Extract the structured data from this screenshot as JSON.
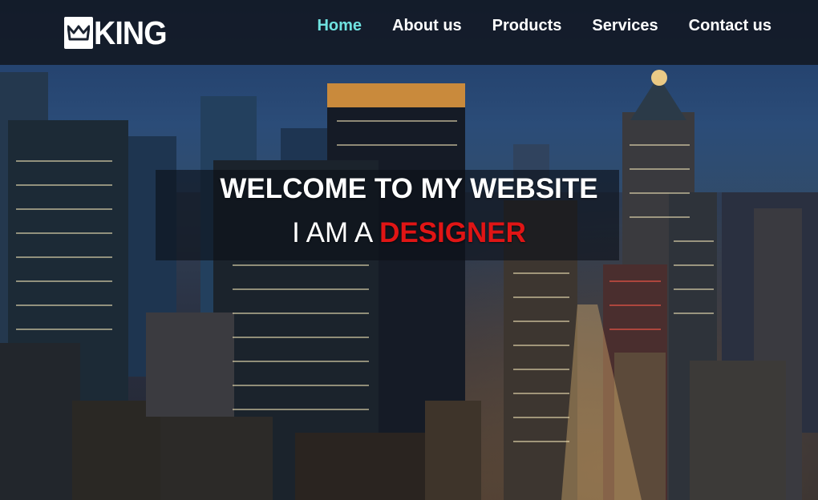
{
  "brand": {
    "logo_text": "KING"
  },
  "nav": {
    "items": [
      {
        "label": "Home",
        "active": true
      },
      {
        "label": "About us",
        "active": false
      },
      {
        "label": "Products",
        "active": false
      },
      {
        "label": "Services",
        "active": false
      },
      {
        "label": "Contact us",
        "active": false
      }
    ]
  },
  "hero": {
    "headline": "WELCOME TO MY WEBSITE",
    "subline_prefix": "I AM A",
    "subline_highlight": "DESIGNER"
  },
  "colors": {
    "nav_active": "#6fe2e0",
    "highlight": "#e01515"
  },
  "icons": {
    "logo_mark": "crown-icon"
  }
}
